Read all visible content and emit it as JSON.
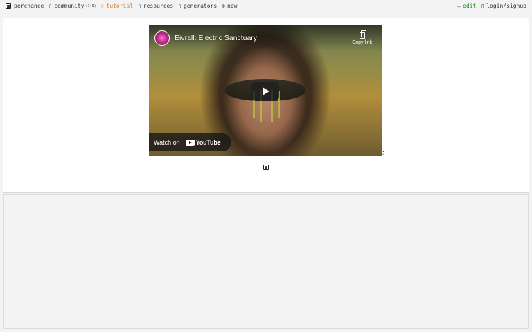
{
  "nav": {
    "items": [
      {
        "label": "perchance",
        "icon": "die-icon"
      },
      {
        "label": "community",
        "count": "(146)",
        "icon": "community-icon"
      },
      {
        "label": "tutorial",
        "icon": "tutorial-icon",
        "active": true
      },
      {
        "label": "resources",
        "icon": "resources-icon"
      },
      {
        "label": "generators",
        "icon": "generators-icon"
      },
      {
        "label": "new",
        "icon": "plus-circle-icon"
      }
    ],
    "edit_label": "edit",
    "login_label": "login/signup"
  },
  "video": {
    "title": "Eivrall: Electric Sanctuary",
    "copy_label": "Copy link",
    "watch_label": "Watch on",
    "platform": "YouTube"
  },
  "trailing_char": ";",
  "colors": {
    "active": "#d97a2a",
    "edit": "#2f8a2f",
    "background": "#f3f3f3"
  }
}
